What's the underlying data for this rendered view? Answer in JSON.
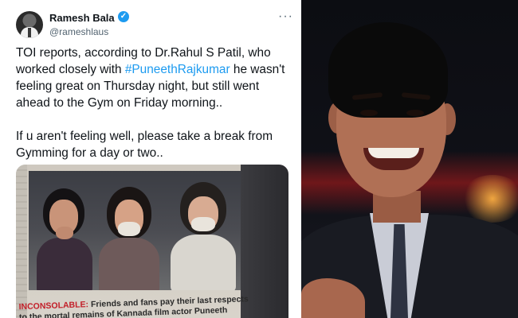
{
  "tweet": {
    "author_name": "Ramesh Bala",
    "handle": "@rameshlaus",
    "verified": true,
    "more_icon": "more-horizontal-icon",
    "text_part1_before": "TOI reports, according to Dr.Rahul S Patil, who worked closely with ",
    "hashtag": "#PuneethRajkumar",
    "text_part1_after": " he wasn't feeling great on Thursday night, but still went ahead to the Gym on Friday morning..",
    "text_part2": "If u aren't feeling well, please take a break from Gymming for a day or two.."
  },
  "news_clipping": {
    "caption_label": "INCONSOLABLE:",
    "caption_text": " Friends and fans pay their last respects to the mortal remains of Kannada film actor Puneeth Rajkumar at the"
  },
  "colors": {
    "link": "#1d9bf0",
    "verified_badge": "#1d9bf0",
    "caption_label": "#c3202a"
  }
}
